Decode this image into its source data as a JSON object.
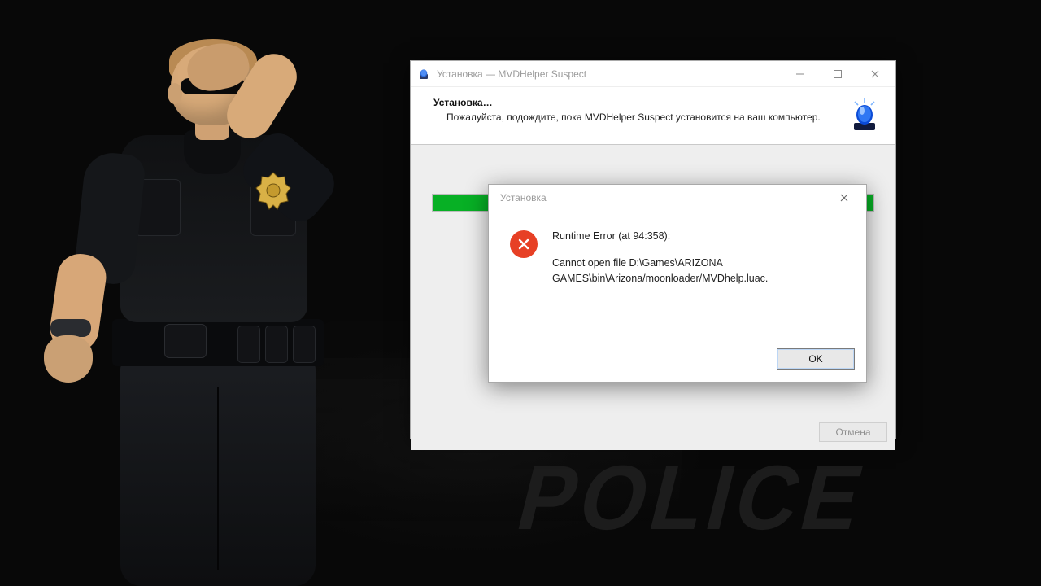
{
  "installer": {
    "window_title": "Установка — MVDHelper Suspect",
    "header_title": "Установка…",
    "header_text": "Пожалуйста, подождите, пока MVDHelper Suspect установится на ваш компьютер.",
    "cancel_label": "Отмена",
    "progress_percent": 100
  },
  "error_dialog": {
    "title": "Установка",
    "message_line1": "Runtime Error (at 94:358):",
    "message_line2": "Cannot open file D:\\Games\\ARIZONA GAMES\\bin\\Arizona/moonloader/MVDhelp.luac.",
    "ok_label": "OK"
  },
  "background": {
    "car_text": "POLICE"
  }
}
